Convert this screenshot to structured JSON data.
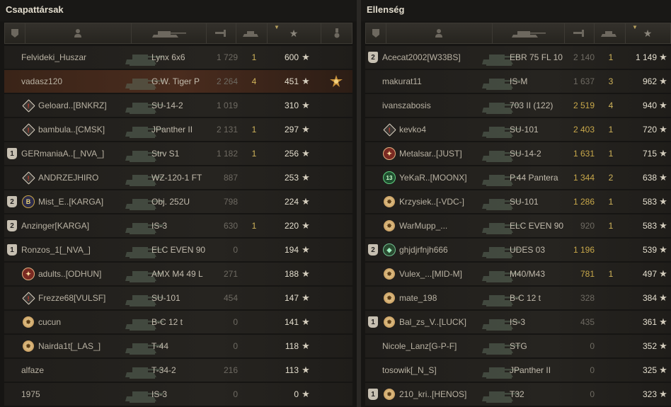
{
  "left_panel": {
    "title": "Csapattársak",
    "rows": [
      {
        "platoon": "",
        "mark": "",
        "name": "Felvideki_Huszar",
        "vehicle": "Lynx 6x6",
        "damage": "1 729",
        "kills": "1",
        "xp": "600",
        "medal": ""
      },
      {
        "platoon": "",
        "mark": "",
        "name": "vadasz120",
        "vehicle": "G.W. Tiger P",
        "damage": "2 264",
        "kills": "4",
        "xp": "451",
        "medal": "order-medal",
        "highlight": true
      },
      {
        "platoon": "",
        "mark": "dia",
        "name": "Geloard..[BNKRZ]",
        "vehicle": "SU-14-2",
        "damage": "1 019",
        "kills": "",
        "xp": "310",
        "medal": ""
      },
      {
        "platoon": "",
        "mark": "dia",
        "name": "bambula..[CMSK]",
        "vehicle": "JPanther II",
        "damage": "2 131",
        "kills": "1",
        "xp": "297",
        "medal": ""
      },
      {
        "platoon": "1",
        "mark": "",
        "name": "GERmaniaA..[_NVA_]",
        "vehicle": "Strv S1",
        "damage": "1 182",
        "kills": "1",
        "xp": "256",
        "medal": ""
      },
      {
        "platoon": "",
        "mark": "dia",
        "name": "ANDRZEJHIRO",
        "vehicle": "WZ-120-1 FT",
        "damage": "887",
        "kills": "",
        "xp": "253",
        "medal": ""
      },
      {
        "platoon": "2",
        "mark": "B",
        "name": "Mist_E..[KARGA]",
        "vehicle": "Obj. 252U",
        "damage": "798",
        "kills": "",
        "xp": "224",
        "medal": ""
      },
      {
        "platoon": "2",
        "mark": "",
        "name": "Anzinger[KARGA]",
        "vehicle": "IS-3",
        "damage": "630",
        "kills": "1",
        "xp": "220",
        "medal": ""
      },
      {
        "platoon": "1",
        "mark": "",
        "name": "Ronzos_1[_NVA_]",
        "vehicle": "ELC EVEN 90",
        "damage": "0",
        "kills": "",
        "xp": "194",
        "medal": ""
      },
      {
        "platoon": "",
        "mark": "red",
        "name": "adults..[ODHUN]",
        "vehicle": "AMX M4 49 L",
        "damage": "271",
        "kills": "",
        "xp": "188",
        "medal": ""
      },
      {
        "platoon": "",
        "mark": "dia",
        "name": "Frezze68[VULSF]",
        "vehicle": "SU-101",
        "damage": "454",
        "kills": "",
        "xp": "147",
        "medal": ""
      },
      {
        "platoon": "",
        "mark": "star",
        "name": "cucun",
        "vehicle": "B-C 12 t",
        "damage": "0",
        "kills": "",
        "xp": "141",
        "medal": ""
      },
      {
        "platoon": "",
        "mark": "star",
        "name": "Nairda1t[_LAS_]",
        "vehicle": "T-44",
        "damage": "0",
        "kills": "",
        "xp": "118",
        "medal": ""
      },
      {
        "platoon": "",
        "mark": "",
        "name": "alfaze",
        "vehicle": "T-34-2",
        "damage": "216",
        "kills": "",
        "xp": "113",
        "medal": ""
      },
      {
        "platoon": "",
        "mark": "",
        "name": "1975",
        "vehicle": "IS-3",
        "damage": "0",
        "kills": "",
        "xp": "0",
        "medal": ""
      }
    ]
  },
  "right_panel": {
    "title": "Ellenség",
    "rows": [
      {
        "platoon": "2",
        "mark": "",
        "name": "Acecat2002[W33BS]",
        "vehicle": "EBR 75 FL 10",
        "damage": "2 140",
        "kills": "1",
        "xp": "1 149",
        "hi": false
      },
      {
        "platoon": "",
        "mark": "",
        "name": "makurat11",
        "vehicle": "IS-M",
        "damage": "1 637",
        "kills": "3",
        "xp": "962",
        "hi": false
      },
      {
        "platoon": "",
        "mark": "",
        "name": "ivanszabosis",
        "vehicle": "703 II (122)",
        "damage": "2 519",
        "kills": "4",
        "xp": "940",
        "hi": true
      },
      {
        "platoon": "",
        "mark": "dia",
        "name": "kevko4",
        "vehicle": "SU-101",
        "damage": "2 403",
        "kills": "1",
        "xp": "720",
        "hi": true
      },
      {
        "platoon": "",
        "mark": "red",
        "name": "Metalsar..[JUST]",
        "vehicle": "SU-14-2",
        "damage": "1 631",
        "kills": "1",
        "xp": "715",
        "hi": true
      },
      {
        "platoon": "",
        "mark": "c13",
        "name": "YeKaR..[MOONX]",
        "vehicle": "P.44 Pantera",
        "damage": "1 344",
        "kills": "2",
        "xp": "638",
        "hi": true
      },
      {
        "platoon": "",
        "mark": "star",
        "name": "Krzysiek..[-VDC-]",
        "vehicle": "SU-101",
        "damage": "1 286",
        "kills": "1",
        "xp": "583",
        "hi": true
      },
      {
        "platoon": "",
        "mark": "star",
        "name": "WarMupp_...",
        "vehicle": "ELC EVEN 90",
        "damage": "920",
        "kills": "1",
        "xp": "583",
        "hi": false
      },
      {
        "platoon": "2",
        "mark": "gem",
        "name": "ghjdjrfnjh666",
        "vehicle": "UDES 03",
        "damage": "1 196",
        "kills": "",
        "xp": "539",
        "hi": true
      },
      {
        "platoon": "",
        "mark": "star",
        "name": "Vulex_...[MID-M]",
        "vehicle": "M40/M43",
        "damage": "781",
        "kills": "1",
        "xp": "497",
        "hi": true
      },
      {
        "platoon": "",
        "mark": "star",
        "name": "mate_198",
        "vehicle": "B-C 12 t",
        "damage": "328",
        "kills": "",
        "xp": "384",
        "hi": false
      },
      {
        "platoon": "1",
        "mark": "star",
        "name": "Bal_zs_V..[LUCK]",
        "vehicle": "IS-3",
        "damage": "435",
        "kills": "",
        "xp": "361",
        "hi": false
      },
      {
        "platoon": "",
        "mark": "",
        "name": "Nicole_Lanz[G-P-F]",
        "vehicle": "STG",
        "damage": "0",
        "kills": "",
        "xp": "352",
        "hi": false
      },
      {
        "platoon": "",
        "mark": "",
        "name": "tosowik[_N_S]",
        "vehicle": "JPanther II",
        "damage": "0",
        "kills": "",
        "xp": "325",
        "hi": false
      },
      {
        "platoon": "1",
        "mark": "star",
        "name": "210_kri..[HENOS]",
        "vehicle": "T32",
        "damage": "0",
        "kills": "",
        "xp": "323",
        "hi": false
      }
    ]
  },
  "star_glyph": "★",
  "colors": {
    "accent": "#c8a84a",
    "kills": "#d0b45a",
    "bg": "#161513"
  }
}
